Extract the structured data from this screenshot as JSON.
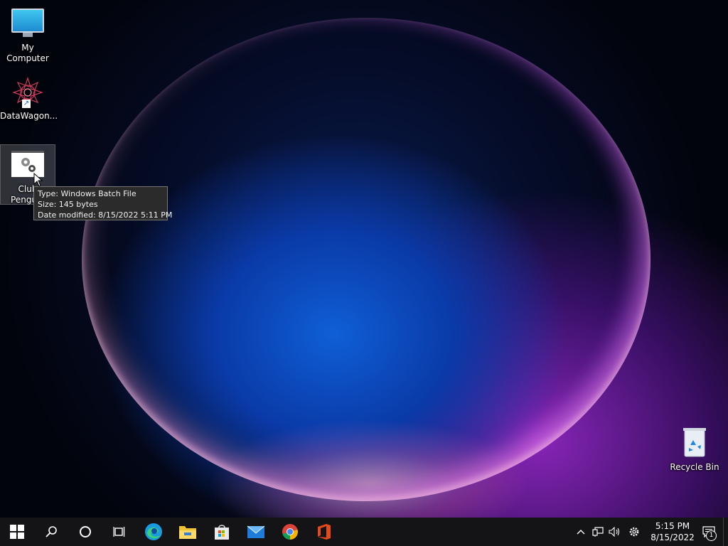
{
  "desktop": {
    "icons": [
      {
        "label": "My Computer",
        "icon": "monitor-icon"
      },
      {
        "label": "DataWagon...",
        "icon": "mandala-shortcut-icon"
      },
      {
        "label": "Club Penguin",
        "icon": "batch-file-icon",
        "selected": true
      },
      {
        "label": "Recycle Bin",
        "icon": "recycle-bin-icon"
      }
    ]
  },
  "tooltip": {
    "type_line": "Type: Windows Batch File",
    "size_line": "Size: 145 bytes",
    "date_line": "Date modified: 8/15/2022 5:11 PM"
  },
  "taskbar": {
    "pinned": [
      {
        "name": "start",
        "icon": "windows-logo-icon"
      },
      {
        "name": "search",
        "icon": "search-icon"
      },
      {
        "name": "cortana",
        "icon": "cortana-circle-icon"
      },
      {
        "name": "task-view",
        "icon": "task-view-icon"
      },
      {
        "name": "edge",
        "icon": "edge-icon"
      },
      {
        "name": "file-explorer",
        "icon": "folder-icon"
      },
      {
        "name": "store",
        "icon": "store-bag-icon"
      },
      {
        "name": "mail",
        "icon": "mail-icon"
      },
      {
        "name": "chrome",
        "icon": "chrome-icon"
      },
      {
        "name": "office",
        "icon": "office-icon"
      }
    ],
    "tray": {
      "icons": [
        "chevron-up-icon",
        "network-icon",
        "volume-icon",
        "settings-gear-icon"
      ],
      "time": "5:15 PM",
      "date": "8/15/2022",
      "notification_count": "1"
    }
  },
  "colors": {
    "taskbar_bg": "#141416",
    "tooltip_bg": "#2b2b2b"
  }
}
